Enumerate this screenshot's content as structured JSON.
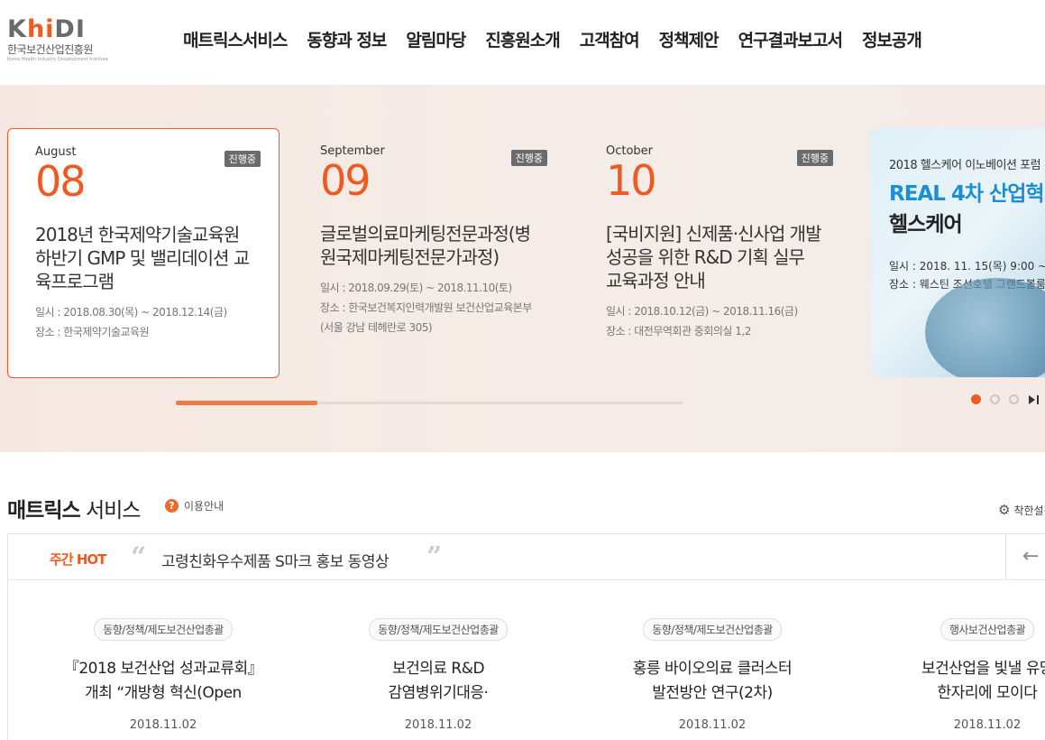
{
  "logo": {
    "brand_prefix": "K",
    "brand_hi": "hi",
    "brand_suffix": "DI",
    "korean_name": "한국보건산업진흥원",
    "english_name": "Korea Health Industry Development Institute"
  },
  "nav": [
    {
      "label": "매트릭스서비스"
    },
    {
      "label": "동향과 정보"
    },
    {
      "label": "알림마당"
    },
    {
      "label": "진흥원소개"
    },
    {
      "label": "고객참여"
    },
    {
      "label": "정책제안"
    },
    {
      "label": "연구결과보고서"
    },
    {
      "label": "정보공개"
    }
  ],
  "hero": {
    "cards": [
      {
        "month": "August",
        "day": "08",
        "badge": "진행중",
        "title": "2018년 한국제약기술교육원 하반기 GMP 및 밸리데이션 교육프로그램",
        "period": "일시 : 2018.08.30(목) ~ 2018.12.14(금)",
        "place": "장소 : 한국제약기술교육원"
      },
      {
        "month": "September",
        "day": "09",
        "badge": "진행중",
        "title": "글로벌의료마케팅전문과정(병원국제마케팅전문가과정)",
        "period": "일시 : 2018.09.29(토) ~ 2018.11.10(토)",
        "place": "장소 : 한국보건복지인력개발원 보건산업교육본부(서울 강남 테헤란로 305)"
      },
      {
        "month": "October",
        "day": "10",
        "badge": "진행중",
        "title": "[국비지원] 신제품·신사업 개발 성공을 위한 R&D 기획 실무 교육과정 안내",
        "period": "일시 : 2018.10.12(금) ~ 2018.11.16(금)",
        "place": "장소 : 대전무역회관 중회의실 1,2"
      }
    ],
    "promo": {
      "line1": "2018 헬스케어 이노베이션 포럼",
      "line2": "REAL 4차 산업혁명",
      "line3": "헬스케어",
      "date": "일시 : 2018. 11. 15(목) 9:00 ~",
      "place": "장소 : 웨스틴 조선호텔 그랜드볼룸"
    },
    "progress": 0.28,
    "slide_count": 3,
    "current_slide": 1
  },
  "matrix": {
    "title_bold": "매트릭스",
    "title_rest": " 서비스",
    "help_icon": "?",
    "help_label": "이용안내",
    "settings_label": "착한설정",
    "hot": {
      "label": "주간 HOT",
      "text": "고령친화우수제품 S마크 홍보 동영상",
      "arrow": "←"
    },
    "items": [
      {
        "tag": "동향/정책/제도보건산업총괄",
        "title1": "『2018 보건산업 성과교류회』",
        "title2": "개최 “개방형 혁신(Open",
        "date": "2018.11.02"
      },
      {
        "tag": "동향/정책/제도보건산업총괄",
        "title1": "보건의료 R&D",
        "title2": "감염병위기대응·",
        "date": "2018.11.02"
      },
      {
        "tag": "동향/정책/제도보건산업총괄",
        "title1": "홍릉 바이오의료 클러스터",
        "title2": "발전방안 연구(2차)",
        "date": "2018.11.02"
      },
      {
        "tag": "행사보건산업총괄",
        "title1": "보건산업을 빛낼 유망",
        "title2": "한자리에 모이다",
        "date": "2018.11.02"
      }
    ]
  },
  "colors": {
    "accent": "#ef5a22",
    "hero_bg": "#f6e8e1",
    "promo_blue": "#1b8fd4"
  }
}
